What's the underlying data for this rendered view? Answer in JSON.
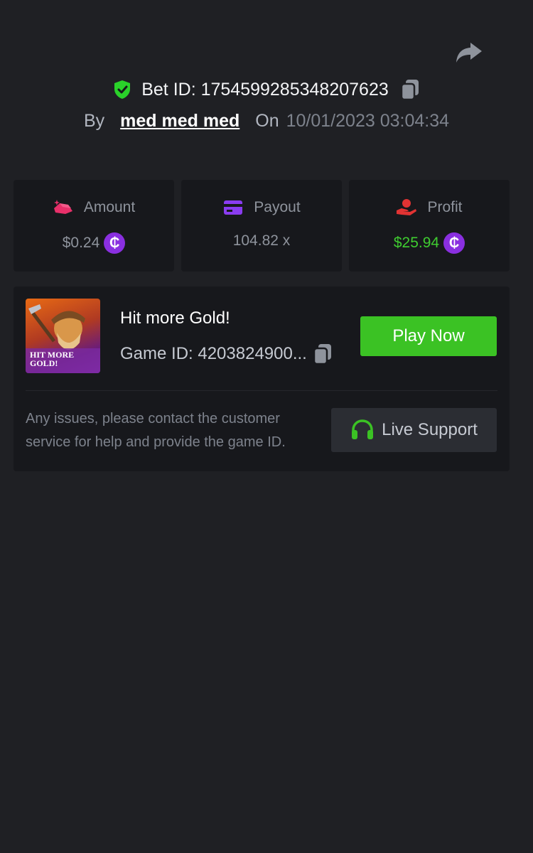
{
  "header": {
    "share_icon": "share-arrow-icon",
    "bet_id_label": "Bet ID: 1754599285348207623",
    "by_label": "By",
    "username": "med med med",
    "on_label": "On",
    "datetime": "10/01/2023 03:04:34"
  },
  "stats": [
    {
      "label": "Amount",
      "value": "$0.24",
      "icon": "gold-bars-icon",
      "icon_color": "#e8306a",
      "has_coin": true,
      "value_color": "#8e939c"
    },
    {
      "label": "Payout",
      "value": "104.82 x",
      "icon": "card-icon",
      "icon_color": "#8a3cf0",
      "has_coin": false,
      "value_color": "#8e939c"
    },
    {
      "label": "Profit",
      "value": "$25.94",
      "icon": "hand-coin-icon",
      "icon_color": "#e23333",
      "has_coin": true,
      "value_color": "#3fcc30"
    }
  ],
  "coin_symbol": "₵",
  "game": {
    "thumb_title": "HIT MORE GOLD!",
    "title": "Hit more Gold!",
    "game_id": "Game ID: 4203824900...",
    "play_label": "Play Now",
    "play_color": "#3bc224"
  },
  "support": {
    "help_text": "Any issues, please contact the customer service for help and provide the game ID.",
    "button_label": "Live Support",
    "icon": "headset-icon",
    "icon_color": "#3bc224"
  },
  "colors": {
    "background": "#1f2024",
    "card": "#17181c",
    "verified": "#2ad12a"
  }
}
